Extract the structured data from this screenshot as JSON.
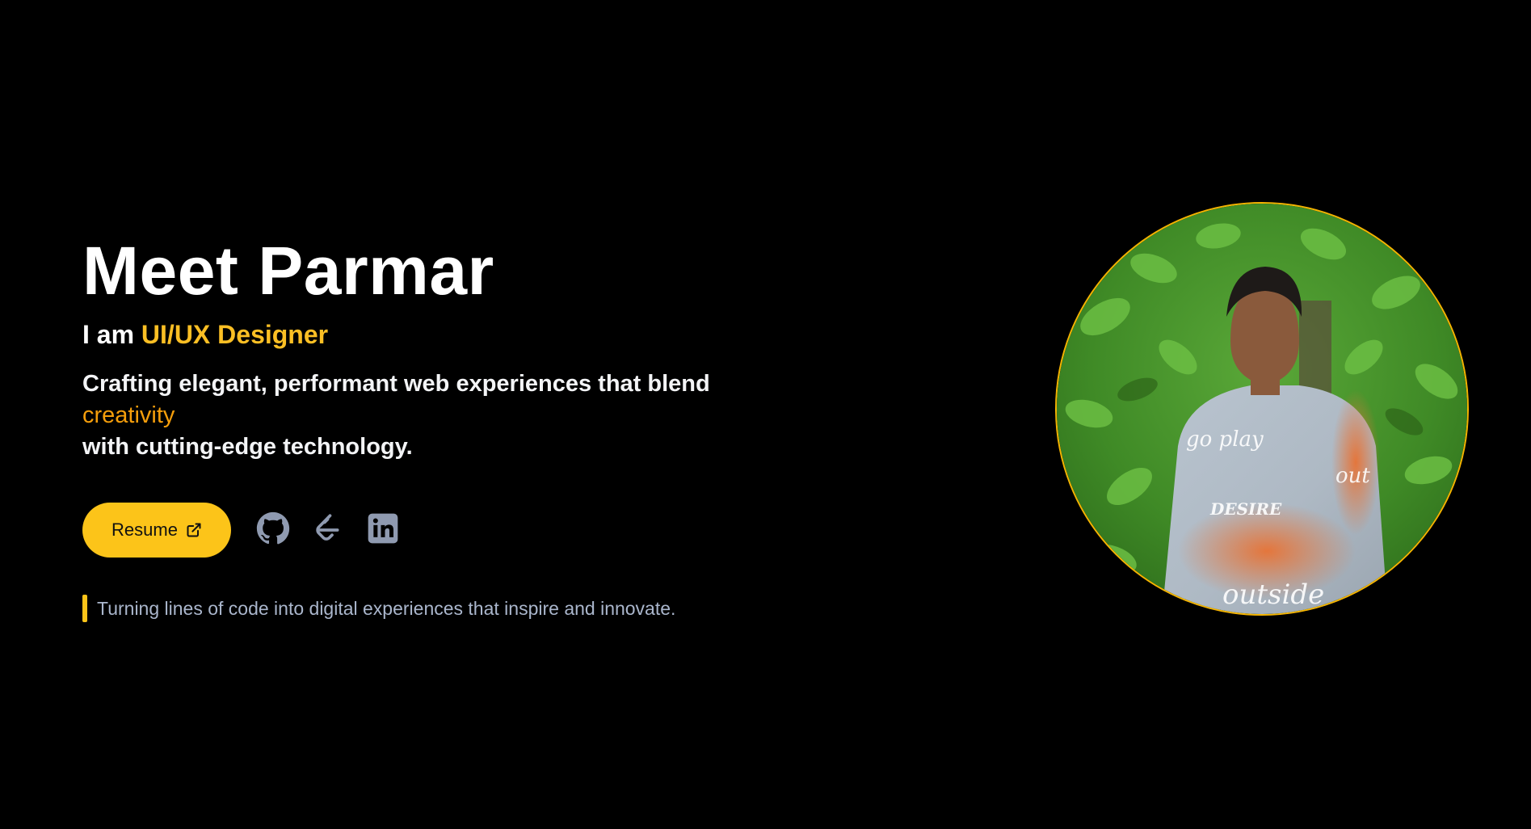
{
  "hero": {
    "name": "Meet Parmar",
    "role_prefix": "I am",
    "role_highlight": "UI/UX Designer",
    "tagline_start": "Crafting elegant, performant web experiences that blend",
    "tagline_highlight": "creativity",
    "tagline_end": "with cutting-edge technology.",
    "quote": "Turning lines of code into digital experiences that inspire and innovate."
  },
  "actions": {
    "resume_label": "Resume",
    "resume_icon": "external-link-icon",
    "social": [
      {
        "name": "github",
        "icon": "github-icon"
      },
      {
        "name": "leetcode",
        "icon": "leetcode-icon"
      },
      {
        "name": "linkedin",
        "icon": "linkedin-icon"
      }
    ]
  },
  "colors": {
    "background": "#000000",
    "accent": "#fcc419",
    "role_accent": "#fbbf24",
    "highlight": "#f59e0b",
    "icon": "#8f9ab0",
    "quote_text": "#aab6cc"
  },
  "profile_photo": {
    "shirt_text": [
      "go play",
      "DESIRE",
      "outside",
      "out"
    ]
  }
}
